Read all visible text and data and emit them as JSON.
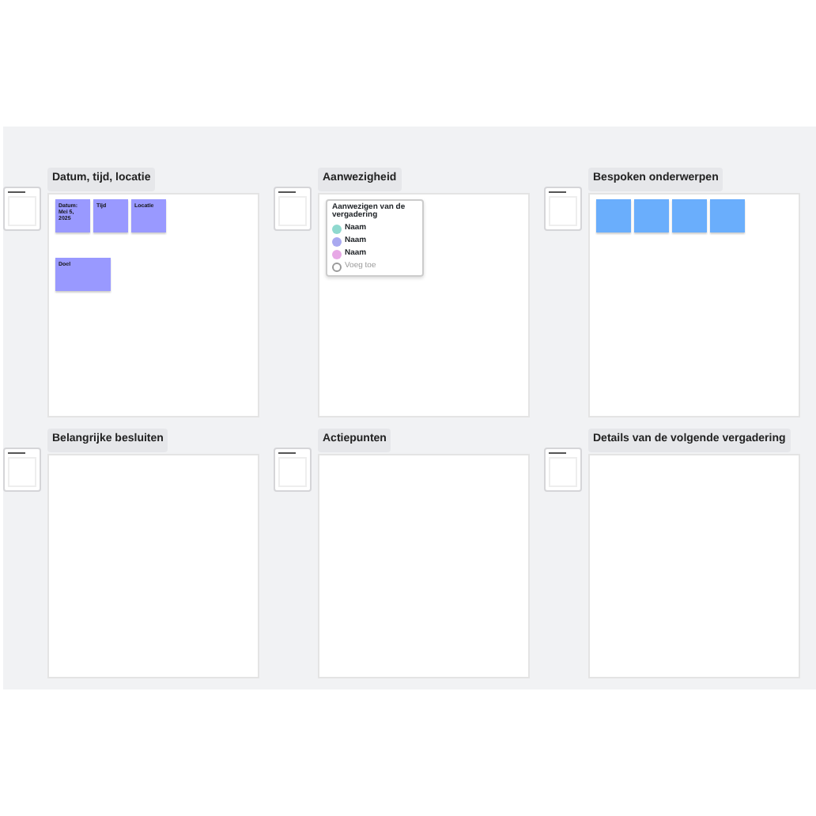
{
  "sections": [
    {
      "title": "Datum, tijd, locatie",
      "kind": "notes",
      "notes": [
        {
          "text": "Datum: Mei 5, 2025",
          "color": "#9999ff",
          "kind": "square"
        },
        {
          "text": "Tijd",
          "color": "#9999ff",
          "kind": "square"
        },
        {
          "text": "Locatie",
          "color": "#9999ff",
          "kind": "square"
        },
        {
          "text": "Doel",
          "color": "#9999ff",
          "kind": "wide"
        }
      ]
    },
    {
      "title": "Aanwezigheid",
      "kind": "attendance",
      "card": {
        "title": "Aanwezigen van de vergadering",
        "people": [
          {
            "name": "Naam",
            "color": "#8fd9cf"
          },
          {
            "name": "Naam",
            "color": "#a9a9f0"
          },
          {
            "name": "Naam",
            "color": "#e7a8e6"
          }
        ],
        "add_label": "Voeg toe"
      }
    },
    {
      "title": "Bespoken onderwerpen",
      "kind": "notes",
      "notes": [
        {
          "color": "#6aaefc",
          "kind": "square"
        },
        {
          "color": "#6aaefc",
          "kind": "square"
        },
        {
          "color": "#6aaefc",
          "kind": "square"
        },
        {
          "color": "#6aaefc",
          "kind": "square"
        }
      ]
    },
    {
      "title": "Belangrijke besluiten",
      "kind": "empty"
    },
    {
      "title": "Actiepunten",
      "kind": "empty"
    },
    {
      "title": "Details van de volgende vergadering",
      "kind": "empty"
    }
  ]
}
